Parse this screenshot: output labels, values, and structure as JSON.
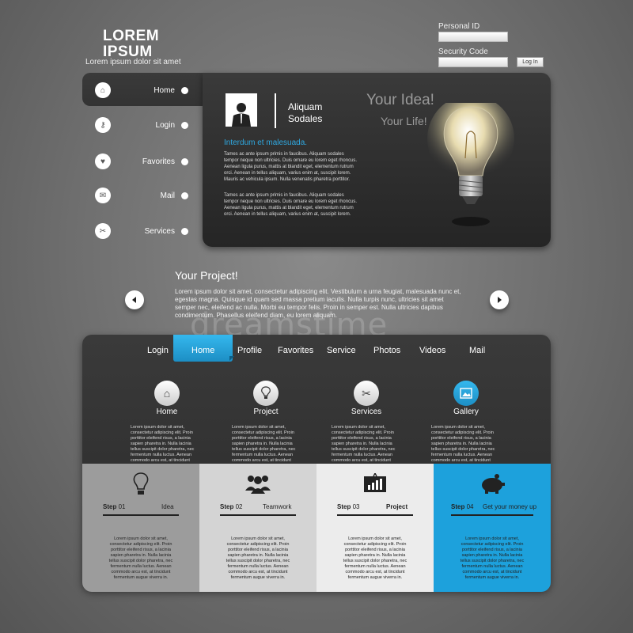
{
  "logo": {
    "title": "LOREM IPSUM",
    "subtitle": "Lorem ipsum dolor sit amet"
  },
  "login": {
    "id_label": "Personal ID",
    "code_label": "Security Code",
    "button": "Log In"
  },
  "side_nav": [
    {
      "label": "Home",
      "icon": "home-icon"
    },
    {
      "label": "Login",
      "icon": "key-icon"
    },
    {
      "label": "Favorites",
      "icon": "heart-icon"
    },
    {
      "label": "Mail",
      "icon": "mail-icon"
    },
    {
      "label": "Services",
      "icon": "tools-icon"
    }
  ],
  "profile": {
    "name_line1": "Aliquam",
    "name_line2": "Sodales",
    "subheading": "Interdum et malesuada.",
    "para1": "Tames ac ante ipsum primis in faucibus. Aliquam sodales tempor neque non ultricies. Duis ornare eu lorem eget rhoncus. Aenean ligula purus, mattis at blandit eget, elementum rutrum orci. Aenean in tellus aliquam, varius enim at, suscipit lorem. Mauris ac vehicula ipsum. Nulla venenatis pharetra porttitor.",
    "para2": "Tames ac ante ipsum primis in faucibus. Aliquam sodales tempor neque non ultricies. Duis ornare eu lorem eget rhoncus. Aenean ligula purus, mattis at blandit eget, elementum rutrum orci. Aenean in tellus aliquam, varius enim at, suscipit lorem."
  },
  "idea": {
    "line1": "Your Idea!",
    "line2": "Your Life!"
  },
  "project": {
    "title": "Your Project!",
    "text": "Lorem ipsum dolor sit amet, consectetur adipiscing elit. Vestibulum a urna feugiat, malesuada nunc et, egestas magna. Quisque id quam sed massa pretium iaculis. Nulla turpis nunc, ultricies sit amet semper nec, eleifend ac nulla. Morbi eu tempor felis. Proin in semper est. Nulla ultricies dapibus condimentum. Phasellus eleifend diam, eu lorem aliquam."
  },
  "watermark": "dreamstime",
  "menu": [
    "Login",
    "Home",
    "Profile",
    "Favorites",
    "Service",
    "Photos",
    "Videos",
    "Mail"
  ],
  "features": [
    {
      "label": "Home",
      "icon": "home-icon"
    },
    {
      "label": "Project",
      "icon": "bulb-icon"
    },
    {
      "label": "Services",
      "icon": "tools-icon"
    },
    {
      "label": "Gallery",
      "icon": "gallery-icon"
    }
  ],
  "feature_text": "Lorem ipsum dolor sit amet, consectetur adipiscing elit. Proin porttitor eleifend risus, a lacinia sapien pharetra in. Nulla lacinia tellus suscipit dolor pharetra, nec fermentum nulla luctus. Aenean commodo arcu est, at tincidunt fermentum augue viverra in.",
  "steps": [
    {
      "word": "Step",
      "num": "01",
      "title": "Idea",
      "bg": "#9c9c9c"
    },
    {
      "word": "Step",
      "num": "02",
      "title": "Teamwork",
      "bg": "#d4d4d4"
    },
    {
      "word": "Step",
      "num": "03",
      "title": "Project",
      "bg": "#ececec"
    },
    {
      "word": "Step",
      "num": "04",
      "title": "Get your money up",
      "bg": "#1da1dc"
    }
  ],
  "colors": {
    "accent": "#2fa8e0",
    "panel": "#2f2f2f",
    "background": "#777777"
  }
}
